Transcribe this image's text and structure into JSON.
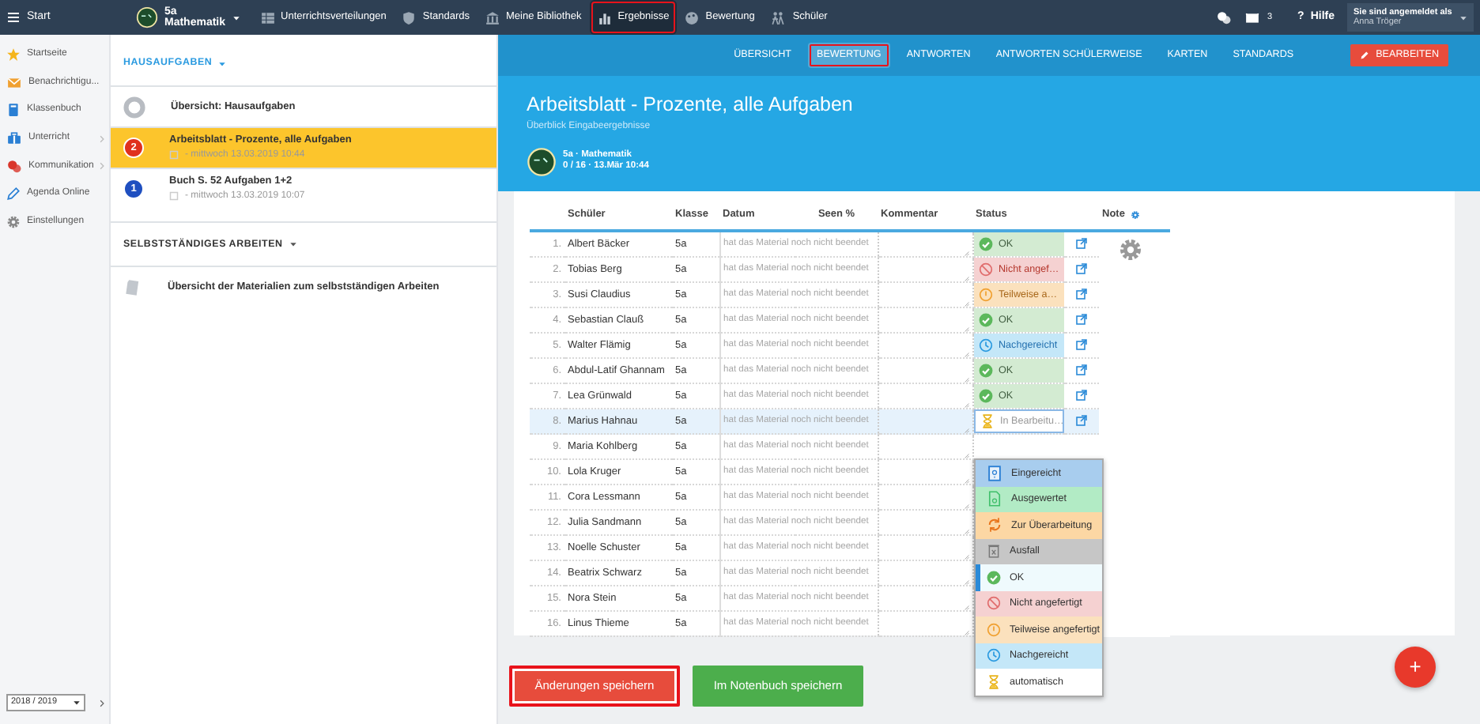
{
  "top_bar": {
    "start": "Start",
    "course": {
      "name": "5a",
      "subject": "Mathematik"
    },
    "nav": [
      {
        "label": "Unterrichtsverteilungen",
        "selected": false,
        "highlighted": false
      },
      {
        "label": "Standards",
        "selected": false,
        "highlighted": false
      },
      {
        "label": "Meine Bibliothek",
        "selected": false,
        "highlighted": false
      },
      {
        "label": "Ergebnisse",
        "selected": true,
        "highlighted": true
      },
      {
        "label": "Bewertung",
        "selected": false,
        "highlighted": false
      },
      {
        "label": "Schüler",
        "selected": false,
        "highlighted": false
      }
    ],
    "messages_count": "3",
    "help_icon": "?",
    "help": "Hilfe",
    "login": {
      "label": "Sie sind angemeldet als",
      "user": "Anna Tröger"
    }
  },
  "sidebar": {
    "items": [
      {
        "label": "Startseite",
        "has_submenu": false
      },
      {
        "label": "Benachrichtigu...",
        "has_submenu": false
      },
      {
        "label": "Klassenbuch",
        "has_submenu": false
      },
      {
        "label": "Unterricht",
        "has_submenu": true
      },
      {
        "label": "Kommunikation",
        "has_submenu": true
      },
      {
        "label": "Agenda Online",
        "has_submenu": false
      },
      {
        "label": "Einstellungen",
        "has_submenu": false
      }
    ],
    "school_year": "2018 / 2019"
  },
  "homework": {
    "heading": "HAUSAUFGABEN",
    "items": [
      {
        "kind": "overview",
        "title": "Übersicht: Hausaufgaben",
        "selected": false
      },
      {
        "kind": "numbered",
        "number": "2",
        "color": "#e0301e",
        "title": "Arbeitsblatt - Prozente, alle Aufgaben",
        "meta": "- mittwoch 13.03.2019 10:44",
        "selected": true
      },
      {
        "kind": "numbered",
        "number": "1",
        "color": "#1f4fc0",
        "title": "Buch S. 52 Aufgaben 1+2",
        "meta": "- mittwoch 13.03.2019 10:07",
        "selected": false
      }
    ]
  },
  "independent_work": {
    "heading": "SELBSTSTÄNDIGES ARBEITEN",
    "items": [
      {
        "title": "Übersicht der Materialien zum selbstständigen Arbeiten"
      }
    ]
  },
  "tabs": [
    {
      "label": "ÜBERSICHT",
      "selected": false,
      "highlighted": false
    },
    {
      "label": "BEWERTUNG",
      "selected": true,
      "highlighted": true
    },
    {
      "label": "ANTWORTEN",
      "selected": false,
      "highlighted": false
    },
    {
      "label": "ANTWORTEN SCHÜLERWEISE",
      "selected": false,
      "highlighted": false
    },
    {
      "label": "KARTEN",
      "selected": false,
      "highlighted": false
    },
    {
      "label": "STANDARDS",
      "selected": false,
      "highlighted": false
    }
  ],
  "edit_button": "BEARBEITEN",
  "header": {
    "title": "Arbeitsblatt - Prozente, alle Aufgaben",
    "subtitle": "Überblick Eingabeergebnisse",
    "course": "5a · Mathematik",
    "meta": "0 / 16 · 13.Mär 10:44"
  },
  "table": {
    "columns": [
      "Schüler",
      "Klasse",
      "Datum",
      "Seen %",
      "Kommentar",
      "Status",
      "Note"
    ],
    "rows": [
      {
        "number": "1.",
        "name": "Albert Bäcker",
        "class": "5a",
        "progress": "hat das Material noch nicht beendet",
        "selected": false,
        "status": {
          "kind": "ok",
          "label": "OK"
        }
      },
      {
        "number": "2.",
        "name": "Tobias Berg",
        "class": "5a",
        "progress": "hat das Material noch nicht beendet",
        "selected": false,
        "status": {
          "kind": "not_done",
          "label": "Nicht angef…"
        }
      },
      {
        "number": "3.",
        "name": "Susi Claudius",
        "class": "5a",
        "progress": "hat das Material noch nicht beendet",
        "selected": false,
        "status": {
          "kind": "partial",
          "label": "Teilweise a…"
        }
      },
      {
        "number": "4.",
        "name": "Sebastian Clauß",
        "class": "5a",
        "progress": "hat das Material noch nicht beendet",
        "selected": false,
        "status": {
          "kind": "ok",
          "label": "OK"
        }
      },
      {
        "number": "5.",
        "name": "Walter Flämig",
        "class": "5a",
        "progress": "hat das Material noch nicht beendet",
        "selected": false,
        "status": {
          "kind": "late",
          "label": "Nachgereicht"
        }
      },
      {
        "number": "6.",
        "name": "Abdul-Latif Ghannam",
        "class": "5a",
        "progress": "hat das Material noch nicht beendet",
        "selected": false,
        "status": {
          "kind": "ok",
          "label": "OK"
        }
      },
      {
        "number": "7.",
        "name": "Lea Grünwald",
        "class": "5a",
        "progress": "hat das Material noch nicht beendet",
        "selected": false,
        "status": {
          "kind": "ok",
          "label": "OK"
        }
      },
      {
        "number": "8.",
        "name": "Marius Hahnau",
        "class": "5a",
        "progress": "hat das Material noch nicht beendet",
        "selected": true,
        "status": {
          "kind": "in_progress",
          "label": "In Bearbeitu…"
        }
      },
      {
        "number": "9.",
        "name": "Maria Kohlberg",
        "class": "5a",
        "progress": "hat das Material noch nicht beendet",
        "selected": false
      },
      {
        "number": "10.",
        "name": "Lola Kruger",
        "class": "5a",
        "progress": "hat das Material noch nicht beendet",
        "selected": false
      },
      {
        "number": "11.",
        "name": "Cora Lessmann",
        "class": "5a",
        "progress": "hat das Material noch nicht beendet",
        "selected": false
      },
      {
        "number": "12.",
        "name": "Julia Sandmann",
        "class": "5a",
        "progress": "hat das Material noch nicht beendet",
        "selected": false
      },
      {
        "number": "13.",
        "name": "Noelle Schuster",
        "class": "5a",
        "progress": "hat das Material noch nicht beendet",
        "selected": false
      },
      {
        "number": "14.",
        "name": "Beatrix Schwarz",
        "class": "5a",
        "progress": "hat das Material noch nicht beendet",
        "selected": false
      },
      {
        "number": "15.",
        "name": "Nora Stein",
        "class": "5a",
        "progress": "hat das Material noch nicht beendet",
        "selected": false
      },
      {
        "number": "16.",
        "name": "Linus Thieme",
        "class": "5a",
        "progress": "hat das Material noch nicht beendet",
        "selected": false
      }
    ]
  },
  "status_menu": {
    "options": [
      {
        "kind": "submitted",
        "label": "Eingereicht",
        "selected": false
      },
      {
        "kind": "evaluated",
        "label": "Ausgewertet",
        "selected": false
      },
      {
        "kind": "revise",
        "label": "Zur Überarbeitung",
        "selected": false
      },
      {
        "kind": "dropped",
        "label": "Ausfall",
        "selected": false
      },
      {
        "kind": "ok",
        "label": "OK",
        "selected": true
      },
      {
        "kind": "not_done",
        "label": "Nicht angefertigt",
        "selected": false
      },
      {
        "kind": "partial",
        "label": "Teilweise angefertigt",
        "selected": false
      },
      {
        "kind": "late",
        "label": "Nachgereicht",
        "selected": false
      },
      {
        "kind": "in_progress",
        "label": "automatisch",
        "selected": false
      }
    ]
  },
  "buttons": [
    {
      "kind": "danger",
      "label": "Änderungen speichern",
      "highlighted": true
    },
    {
      "kind": "success",
      "label": "Im Notenbuch speichern",
      "highlighted": false
    }
  ],
  "fab": "+"
}
